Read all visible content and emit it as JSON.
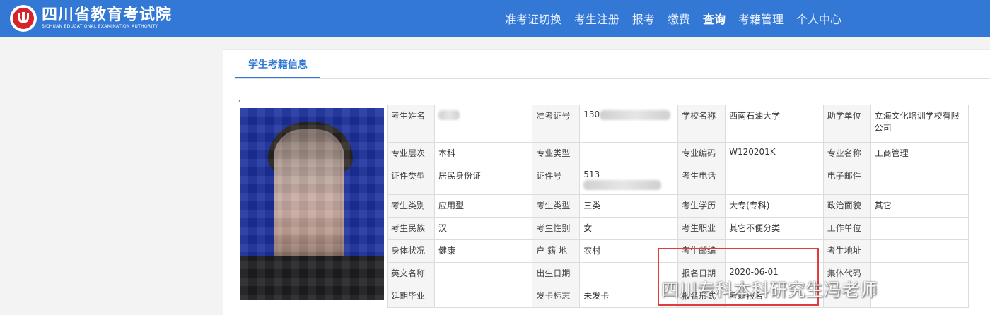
{
  "header": {
    "logo_cn": "四川省教育考试院",
    "logo_en": "SICHUAN EDUCATIONAL EXAMINATION AUTHORITY",
    "nav": [
      {
        "label": "准考证切换",
        "active": false
      },
      {
        "label": "考生注册",
        "active": false
      },
      {
        "label": "报考",
        "active": false
      },
      {
        "label": "缴费",
        "active": false
      },
      {
        "label": "查询",
        "active": true
      },
      {
        "label": "考籍管理",
        "active": false
      },
      {
        "label": "个人中心",
        "active": false
      }
    ]
  },
  "tab": {
    "label": "学生考籍信息"
  },
  "tick": ",",
  "info": {
    "rows": [
      [
        {
          "k": "考生姓名",
          "v": ""
        },
        {
          "k": "准考证号",
          "v": "130"
        },
        {
          "k": "学校名称",
          "v": "西南石油大学"
        },
        {
          "k": "助学单位",
          "v": "立海文化培训学校有限公司"
        }
      ],
      [
        {
          "k": "专业层次",
          "v": "本科"
        },
        {
          "k": "专业类型",
          "v": ""
        },
        {
          "k": "专业编码",
          "v": "W120201K"
        },
        {
          "k": "专业名称",
          "v": "工商管理"
        }
      ],
      [
        {
          "k": "证件类型",
          "v": "居民身份证"
        },
        {
          "k": "证件号",
          "v": "513"
        },
        {
          "k": "考生电话",
          "v": ""
        },
        {
          "k": "电子邮件",
          "v": ""
        }
      ],
      [
        {
          "k": "考生类别",
          "v": "应用型"
        },
        {
          "k": "考生类型",
          "v": "三类"
        },
        {
          "k": "考生学历",
          "v": "大专(专科)"
        },
        {
          "k": "政治面貌",
          "v": "其它"
        }
      ],
      [
        {
          "k": "考生民族",
          "v": "汉"
        },
        {
          "k": "考生性别",
          "v": "女"
        },
        {
          "k": "考生职业",
          "v": "其它不便分类"
        },
        {
          "k": "工作单位",
          "v": ""
        }
      ],
      [
        {
          "k": "身体状况",
          "v": "健康"
        },
        {
          "k": "户 籍 地",
          "v": "农村"
        },
        {
          "k": "考生邮编",
          "v": ""
        },
        {
          "k": "考生地址",
          "v": ""
        }
      ],
      [
        {
          "k": "英文名称",
          "v": ""
        },
        {
          "k": "出生日期",
          "v": ""
        },
        {
          "k": "报名日期",
          "v": "2020-06-01"
        },
        {
          "k": "集体代码",
          "v": ""
        }
      ],
      [
        {
          "k": "延期毕业",
          "v": ""
        },
        {
          "k": "发卡标志",
          "v": "未发卡"
        },
        {
          "k": "报名形式",
          "v": "考籍报名"
        },
        {
          "k": "",
          "v": ""
        }
      ]
    ]
  },
  "watermark": "四川专科本科研究生冯老师",
  "colors": {
    "header": "#3478d6",
    "highlight": "#e43c3c"
  }
}
